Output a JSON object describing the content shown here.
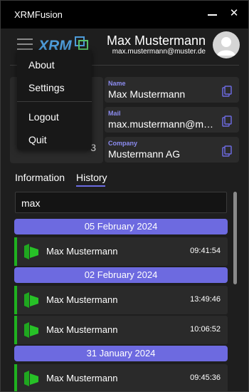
{
  "window": {
    "title": "XRMFusion"
  },
  "header": {
    "logo_text": "XRM",
    "user_name": "Max Mustermann",
    "user_email": "max.mustermann@muster.de"
  },
  "left_panel": {
    "value": "3"
  },
  "contact": {
    "fields": [
      {
        "label": "Name",
        "value": "Max Mustermann"
      },
      {
        "label": "Mail",
        "value": "max.mustermann@muster.de"
      },
      {
        "label": "Company",
        "value": "Mustermann AG"
      }
    ]
  },
  "tabs": [
    {
      "label": "Information",
      "active": false
    },
    {
      "label": "History",
      "active": true
    }
  ],
  "search": {
    "value": "max"
  },
  "history": {
    "groups": [
      {
        "date": "05 February 2024",
        "entries": [
          {
            "name": "Max Mustermann",
            "time": "09:41:54"
          }
        ]
      },
      {
        "date": "02 February 2024",
        "entries": [
          {
            "name": "Max Mustermann",
            "time": "13:49:46"
          },
          {
            "name": "Max Mustermann",
            "time": "10:06:52"
          }
        ]
      },
      {
        "date": "31 January 2024",
        "entries": [
          {
            "name": "Max Mustermann",
            "time": "09:45:36"
          }
        ]
      }
    ]
  },
  "menu": {
    "items": [
      "About",
      "Settings",
      "Logout",
      "Quit"
    ]
  },
  "colors": {
    "accent": "#6d6ae0",
    "entry_marker": "#1fb01f",
    "logo_blue": "#4d9bd8",
    "logo_green": "#58c26a"
  }
}
